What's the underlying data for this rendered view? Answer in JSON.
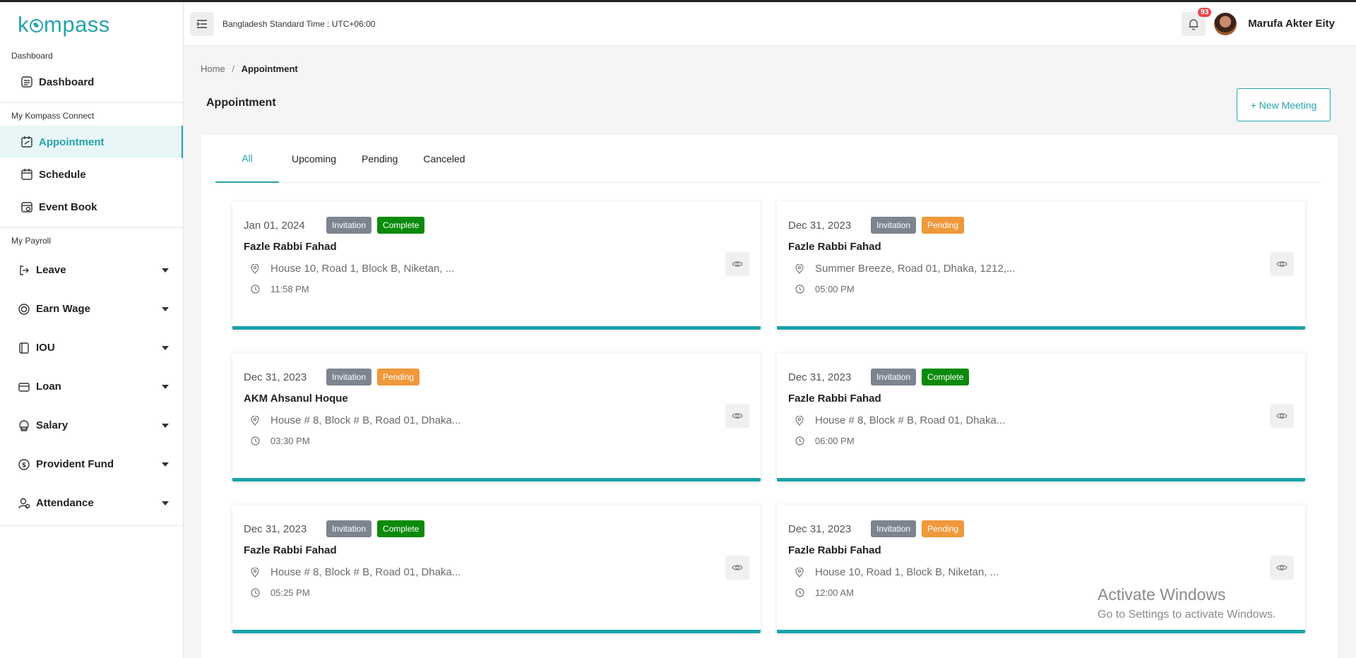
{
  "app": {
    "logo": "kompass"
  },
  "header": {
    "timezone": "Bangladesh Standard Time : UTC+06:00",
    "notification_count": "93",
    "user_name": "Marufa Akter Eity"
  },
  "sidebar": {
    "sections": [
      {
        "title": "Dashboard",
        "items": [
          {
            "label": "Dashboard",
            "icon": "dashboard-icon"
          }
        ]
      },
      {
        "title": "My Kompass Connect",
        "items": [
          {
            "label": "Appointment",
            "icon": "appointment-icon",
            "active": true
          },
          {
            "label": "Schedule",
            "icon": "calendar-icon"
          },
          {
            "label": "Event Book",
            "icon": "event-book-icon"
          }
        ]
      },
      {
        "title": "My Payroll",
        "items": [
          {
            "label": "Leave",
            "icon": "leave-icon"
          },
          {
            "label": "Earn Wage",
            "icon": "earn-wage-icon"
          },
          {
            "label": "IOU",
            "icon": "iou-icon"
          },
          {
            "label": "Loan",
            "icon": "loan-icon"
          },
          {
            "label": "Salary",
            "icon": "salary-icon"
          },
          {
            "label": "Provident Fund",
            "icon": "provident-fund-icon"
          },
          {
            "label": "Attendance",
            "icon": "attendance-icon"
          }
        ]
      }
    ]
  },
  "breadcrumb": {
    "home": "Home",
    "separator": "/",
    "current": "Appointment"
  },
  "page": {
    "title": "Appointment",
    "new_button": "+ New Meeting"
  },
  "tabs": [
    "All",
    "Upcoming",
    "Pending",
    "Canceled"
  ],
  "cards": [
    {
      "date": "Jan 01, 2024",
      "type": "Invitation",
      "status": "Complete",
      "name": "Fazle Rabbi Fahad",
      "address": "House 10, Road 1, Block B, Niketan, ...",
      "time": "11:58 PM"
    },
    {
      "date": "Dec 31, 2023",
      "type": "Invitation",
      "status": "Pending",
      "name": "Fazle Rabbi Fahad",
      "address": "Summer Breeze, Road 01, Dhaka, 1212,...",
      "time": "05:00 PM"
    },
    {
      "date": "Dec 31, 2023",
      "type": "Invitation",
      "status": "Pending",
      "name": "AKM Ahsanul Hoque",
      "address": "House # 8, Block # B, Road 01, Dhaka...",
      "time": "03:30 PM"
    },
    {
      "date": "Dec 31, 2023",
      "type": "Invitation",
      "status": "Complete",
      "name": "Fazle Rabbi Fahad",
      "address": "House # 8, Block # B, Road 01, Dhaka...",
      "time": "06:00 PM"
    },
    {
      "date": "Dec 31, 2023",
      "type": "Invitation",
      "status": "Complete",
      "name": "Fazle Rabbi Fahad",
      "address": "House # 8, Block # B, Road 01, Dhaka...",
      "time": "05:25 PM"
    },
    {
      "date": "Dec 31, 2023",
      "type": "Invitation",
      "status": "Pending",
      "name": "Fazle Rabbi Fahad",
      "address": "House 10, Road 1, Block B, Niketan, ...",
      "time": "12:00 AM"
    }
  ],
  "watermark": {
    "line1": "Activate Windows",
    "line2": "Go to Settings to activate Windows."
  },
  "colors": {
    "accent": "#27a3ad",
    "complete": "#0a8a0a",
    "pending": "#f0983a",
    "invitation": "#7d8490"
  }
}
